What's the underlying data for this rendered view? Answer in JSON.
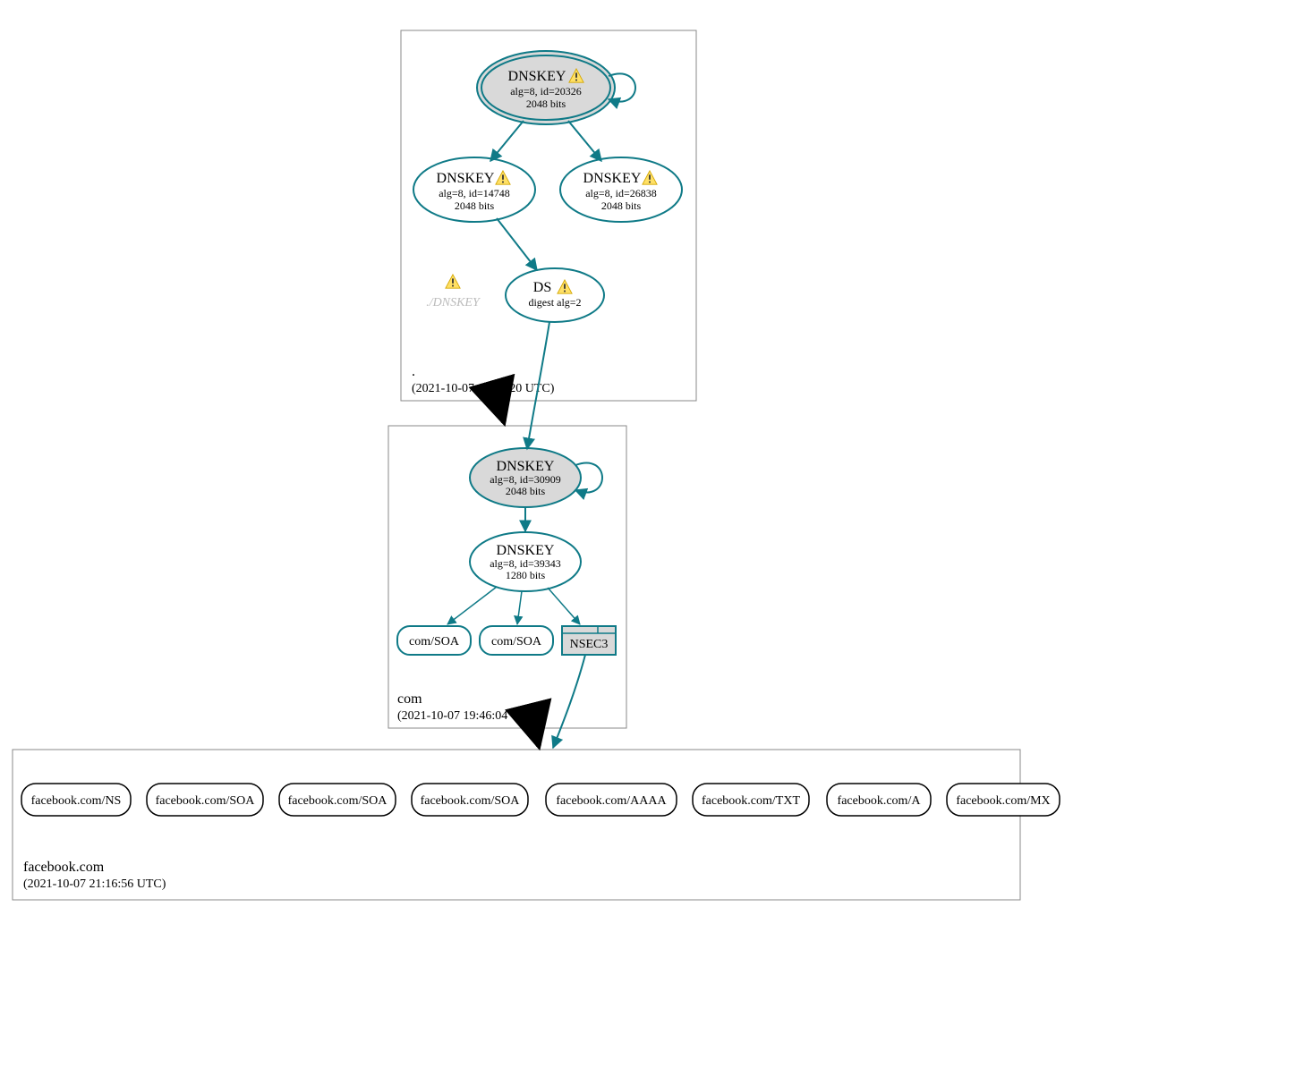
{
  "zones": {
    "root": {
      "label": ".",
      "time": "(2021-10-07 18:02:20 UTC)",
      "nodes": {
        "ksk": {
          "title": "DNSKEY",
          "line1": "alg=8, id=20326",
          "line2": "2048 bits"
        },
        "zsk1": {
          "title": "DNSKEY",
          "line1": "alg=8, id=14748",
          "line2": "2048 bits"
        },
        "zsk2": {
          "title": "DNSKEY",
          "line1": "alg=8, id=26838",
          "line2": "2048 bits"
        },
        "ghost": "./DNSKEY",
        "ds": {
          "title": "DS",
          "line1": "digest alg=2"
        }
      }
    },
    "com": {
      "label": "com",
      "time": "(2021-10-07 19:46:04 UTC)",
      "nodes": {
        "ksk": {
          "title": "DNSKEY",
          "line1": "alg=8, id=30909",
          "line2": "2048 bits"
        },
        "zsk": {
          "title": "DNSKEY",
          "line1": "alg=8, id=39343",
          "line2": "1280 bits"
        },
        "soa1": "com/SOA",
        "soa2": "com/SOA",
        "nsec3": "NSEC3"
      }
    },
    "fb": {
      "label": "facebook.com",
      "time": "(2021-10-07 21:16:56 UTC)",
      "records": [
        "facebook.com/NS",
        "facebook.com/SOA",
        "facebook.com/SOA",
        "facebook.com/SOA",
        "facebook.com/AAAA",
        "facebook.com/TXT",
        "facebook.com/A",
        "facebook.com/MX"
      ]
    }
  }
}
